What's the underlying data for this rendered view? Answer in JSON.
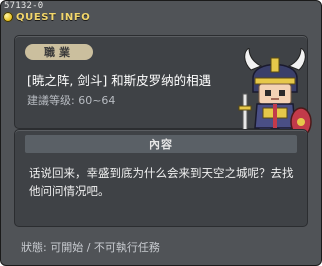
{
  "quest_id": "57132-0",
  "window": {
    "title": "QUEST INFO",
    "title_icon": "quest-bulb-icon"
  },
  "summary": {
    "job_label": "職業",
    "quest_name": "[暁之阵, 剑斗] 和斯皮罗纳的相遇",
    "level_text": "建議等级: 60~64",
    "character": "helmeted-warrior-sprite"
  },
  "content": {
    "header": "內容",
    "body": "话说回来，幸盛到底为什么会来到天空之城呢？去找他问问情况吧。"
  },
  "status_text": "狀態: 可開始 / 不可執行任務",
  "colors": {
    "window_bg": "#505357",
    "panel_bg": "#3f4246",
    "title_gold": "#f2d66b",
    "tag_bg": "#cbbf9e"
  }
}
